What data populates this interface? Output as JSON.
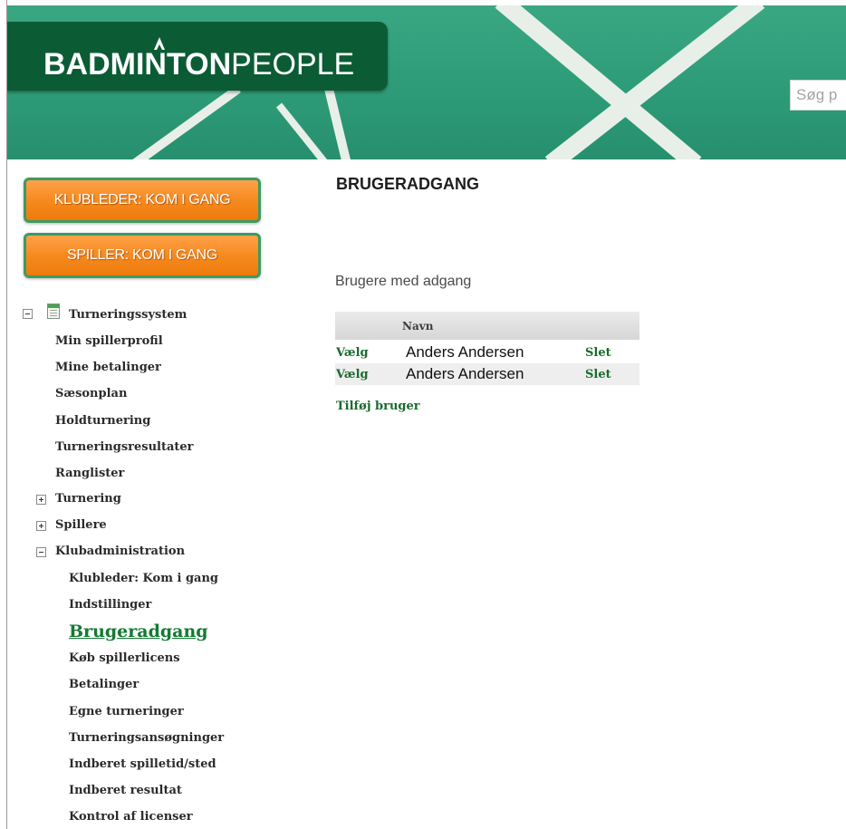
{
  "header": {
    "logo_bold": "BADMINTON",
    "logo_light": "PEOPLE",
    "search_placeholder": "Søg p"
  },
  "cta": {
    "club_leader": "KLUBLEDER: KOM I GANG",
    "player": "SPILLER: KOM I GANG"
  },
  "nav": {
    "root": "Turneringssystem",
    "items": {
      "min_spillerprofil": "Min spillerprofil",
      "mine_betalinger": "Mine betalinger",
      "saesonplan": "Sæsonplan",
      "holdturnering": "Holdturnering",
      "turneringsresultater": "Turneringsresultater",
      "ranglister": "Ranglister",
      "turnering": "Turnering",
      "spillere": "Spillere",
      "klubadministration": "Klubadministration"
    },
    "sub": {
      "klubleder": "Klubleder: Kom i gang",
      "indstillinger": "Indstillinger",
      "brugeradgang": "Brugeradgang",
      "koeb_licens": "Køb spillerlicens",
      "betalinger": "Betalinger",
      "egne_turneringer": "Egne turneringer",
      "ansoegninger": "Turneringsansøgninger",
      "spilletid": "Indberet spilletid/sted",
      "resultat": "Indberet resultat",
      "kontrol": "Kontrol af licenser"
    }
  },
  "main": {
    "title": "BRUGERADGANG",
    "section_title": "Brugere med adgang",
    "table": {
      "header_name": "Navn",
      "rows": [
        {
          "select": "Vælg",
          "name": "Anders Andersen",
          "delete": "Slet"
        },
        {
          "select": "Vælg",
          "name": "Anders Andersen",
          "delete": "Slet"
        }
      ]
    },
    "add_user": "Tilføj bruger"
  },
  "colors": {
    "court_green": "#2d9a77",
    "logo_green": "#0b5c35",
    "cta_orange": "#f68a1f",
    "link_green": "#1a6b2e"
  }
}
